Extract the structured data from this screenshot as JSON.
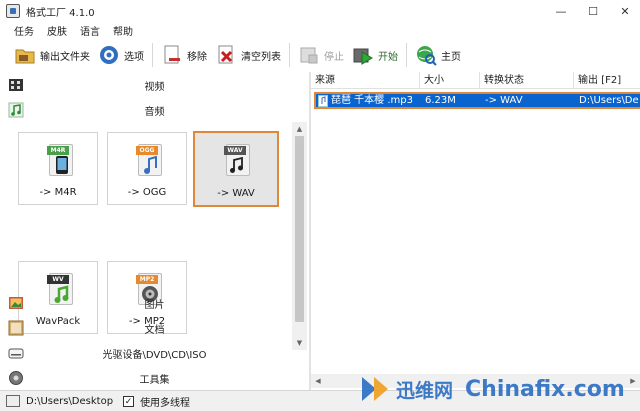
{
  "window": {
    "title": "格式工厂 4.1.0",
    "minimize": "—",
    "maximize": "☐",
    "close": "✕"
  },
  "menu": [
    "任务",
    "皮肤",
    "语言",
    "帮助"
  ],
  "toolbar": {
    "output_folder": "输出文件夹",
    "options": "选项",
    "remove": "移除",
    "clear_list": "清空列表",
    "stop": "停止",
    "start": "开始",
    "home": "主页"
  },
  "left_panel": {
    "categories_top": [
      "视频",
      "音频"
    ],
    "tiles": [
      {
        "label": "-> M4R",
        "tag": "M4R",
        "tag_color": "#4aa04a"
      },
      {
        "label": "-> OGG",
        "tag": "OGG",
        "tag_color": "#e8892c"
      },
      {
        "label": "-> WAV",
        "tag": "WAV",
        "tag_color": "#555555"
      },
      {
        "label": "WavPack",
        "tag": "WV",
        "tag_color": "#333333"
      },
      {
        "label": "-> MP2",
        "tag": "MP2",
        "tag_color": "#e8892c"
      }
    ],
    "categories_bottom": [
      "图片",
      "文档",
      "光驱设备\\DVD\\CD\\ISO",
      "工具集"
    ]
  },
  "file_list": {
    "columns": [
      "来源",
      "大小",
      "转换状态",
      "输出 [F2]"
    ],
    "rows": [
      {
        "source": "琵琶 千本樱 .mp3",
        "size": "6.23M",
        "status": "-> WAV",
        "output": "D:\\Users\\De"
      }
    ]
  },
  "statusbar": {
    "path": "D:\\Users\\Desktop",
    "multithread_label": "使用多线程",
    "multithread_checked": true
  },
  "watermark": {
    "cn": "迅维网",
    "en": "Chinafix.com"
  },
  "colors": {
    "selection": "#0a64cf",
    "highlight_border": "#e0883a",
    "start_green": "#2e6b2e"
  }
}
